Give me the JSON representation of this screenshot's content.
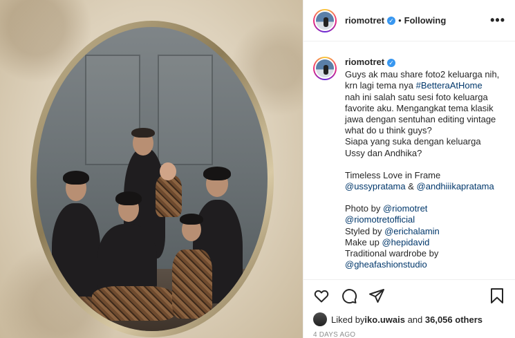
{
  "header": {
    "username": "riomotret",
    "separator": "•",
    "follow_status": "Following",
    "more_label": "•••"
  },
  "caption": {
    "username": "riomotret",
    "lines": [
      "Guys ak mau share foto2 keluarga nih,",
      "krn lagi tema nya ",
      "#BetteraAtHome",
      "nah ini salah satu sesi foto keluarga",
      "favorite aku. Mengangkat tema klasik",
      "jawa dengan sentuhan editing vintage",
      "what do u think guys?",
      "Siapa yang suka dengan keluarga",
      "Ussy dan Andhika?",
      "Timeless Love in Frame",
      "@ussypratama",
      " & ",
      "@andhiiikapratama",
      "Photo by ",
      "@riomotret",
      "@riomotretofficial",
      "Styled by ",
      "@erichalamin",
      "Make up ",
      "@hepidavid",
      "Traditional wardrobe by",
      "@gheafashionstudio"
    ]
  },
  "likes": {
    "prefix": "Liked by ",
    "user": "iko.uwais",
    "middle": " and ",
    "count": "36,056 others"
  },
  "timestamp": "4 DAYS AGO",
  "icons": [
    "heart-icon",
    "comment-icon",
    "share-icon",
    "bookmark-icon",
    "verified-badge-icon",
    "more-options-icon"
  ]
}
